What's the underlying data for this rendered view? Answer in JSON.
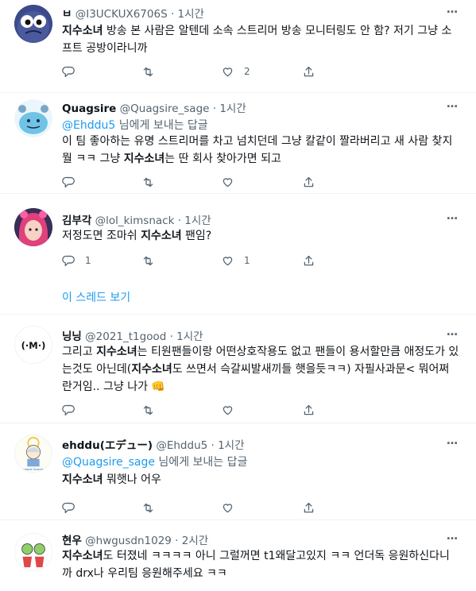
{
  "tweets": [
    {
      "name": "ㅂ",
      "handle": "@I3UCKUX6706S",
      "time": "1시간",
      "body": [
        [
          "b",
          "지수소녀"
        ],
        [
          "t",
          " 방송 본 사람은 알텐데 소속 스트리머 방송 모니터링도 안 함? 저기 그냥 소프트 공방이라니까"
        ]
      ],
      "counts": {
        "reply": "",
        "retweet": "",
        "like": "2"
      }
    },
    {
      "name": "Quagsire",
      "handle": "@Quagsire_sage",
      "time": "1시간",
      "reply_handle": "@Ehddu5",
      "reply_text": " 님에게 보내는 답글",
      "body": [
        [
          "t",
          "이 팀 좋아하는 유명 스트리머를 차고 넘치던데 그냥 칼같이 짤라버리고 새 사람 찾지 뭘 ㅋㅋ 그냥 "
        ],
        [
          "b",
          "지수소녀"
        ],
        [
          "t",
          "는 딴 회사 찾아가면 되고"
        ]
      ],
      "counts": {
        "reply": "",
        "retweet": "",
        "like": ""
      }
    },
    {
      "name": "김부각",
      "handle": "@lol_kimsnack",
      "time": "1시간",
      "body": [
        [
          "t",
          "저정도면 조마쉬 "
        ],
        [
          "b",
          "지수소녀"
        ],
        [
          "t",
          " 팬임?"
        ]
      ],
      "counts": {
        "reply": "1",
        "retweet": "",
        "like": "1"
      },
      "thread_label": "이 스레드 보기"
    },
    {
      "name": "닝닝",
      "handle": "@2021_t1good",
      "time": "1시간",
      "body": [
        [
          "t",
          "그리고 "
        ],
        [
          "b",
          "지수소녀"
        ],
        [
          "t",
          "는 티원팬들이랑 어떤상호작용도 없고 팬들이 용서할만큼 애정도가 있는것도 아닌데("
        ],
        [
          "b",
          "지수소녀"
        ],
        [
          "t",
          "도 쓰면서 슥갈씨발새끼들 햇을듯ㅋㅋ) 자필사과문< 뭐어쩌란거임.. 그냥 나가 👊"
        ]
      ],
      "counts": {
        "reply": "",
        "retweet": "",
        "like": ""
      }
    },
    {
      "name": "ehddu(エデュー)",
      "handle": "@Ehddu5",
      "time": "1시간",
      "reply_handle": "@Quagsire_sage",
      "reply_text": " 님에게 보내는 답글",
      "body": [
        [
          "b",
          "지수소녀"
        ],
        [
          "t",
          " 뭐햇나 어우"
        ]
      ],
      "counts": {
        "reply": "",
        "retweet": "",
        "like": ""
      }
    },
    {
      "name": "현우",
      "handle": "@hwgusdn1029",
      "time": "2시간",
      "body": [
        [
          "b",
          "지수소녀"
        ],
        [
          "t",
          "도 터졌네 ㅋㅋㅋㅋ 아니 그럴꺼면 t1왜달고있지 ㅋㅋ 언더독 응원하신다니까 drx나 우리팀 응원해주세요 ㅋㅋ"
        ]
      ],
      "counts": {
        "reply": "",
        "retweet": "",
        "like": ""
      }
    }
  ],
  "more_icon": "…",
  "icons": [
    "reply-icon",
    "retweet-icon",
    "like-icon",
    "share-icon",
    "more-icon"
  ],
  "colors": {
    "accent": "#1d9bf0",
    "muted": "#536471",
    "text": "#0f1419",
    "divider": "#eff3f4"
  }
}
